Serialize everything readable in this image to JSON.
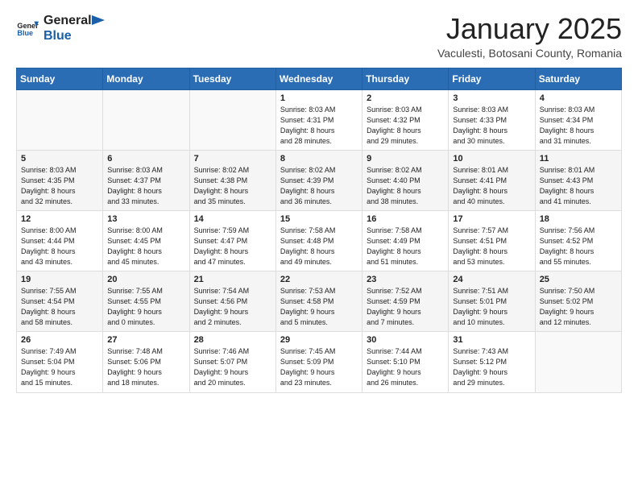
{
  "header": {
    "logo_line1": "General",
    "logo_line2": "Blue",
    "month": "January 2025",
    "location": "Vaculesti, Botosani County, Romania"
  },
  "weekdays": [
    "Sunday",
    "Monday",
    "Tuesday",
    "Wednesday",
    "Thursday",
    "Friday",
    "Saturday"
  ],
  "weeks": [
    [
      {
        "day": "",
        "info": ""
      },
      {
        "day": "",
        "info": ""
      },
      {
        "day": "",
        "info": ""
      },
      {
        "day": "1",
        "info": "Sunrise: 8:03 AM\nSunset: 4:31 PM\nDaylight: 8 hours\nand 28 minutes."
      },
      {
        "day": "2",
        "info": "Sunrise: 8:03 AM\nSunset: 4:32 PM\nDaylight: 8 hours\nand 29 minutes."
      },
      {
        "day": "3",
        "info": "Sunrise: 8:03 AM\nSunset: 4:33 PM\nDaylight: 8 hours\nand 30 minutes."
      },
      {
        "day": "4",
        "info": "Sunrise: 8:03 AM\nSunset: 4:34 PM\nDaylight: 8 hours\nand 31 minutes."
      }
    ],
    [
      {
        "day": "5",
        "info": "Sunrise: 8:03 AM\nSunset: 4:35 PM\nDaylight: 8 hours\nand 32 minutes."
      },
      {
        "day": "6",
        "info": "Sunrise: 8:03 AM\nSunset: 4:37 PM\nDaylight: 8 hours\nand 33 minutes."
      },
      {
        "day": "7",
        "info": "Sunrise: 8:02 AM\nSunset: 4:38 PM\nDaylight: 8 hours\nand 35 minutes."
      },
      {
        "day": "8",
        "info": "Sunrise: 8:02 AM\nSunset: 4:39 PM\nDaylight: 8 hours\nand 36 minutes."
      },
      {
        "day": "9",
        "info": "Sunrise: 8:02 AM\nSunset: 4:40 PM\nDaylight: 8 hours\nand 38 minutes."
      },
      {
        "day": "10",
        "info": "Sunrise: 8:01 AM\nSunset: 4:41 PM\nDaylight: 8 hours\nand 40 minutes."
      },
      {
        "day": "11",
        "info": "Sunrise: 8:01 AM\nSunset: 4:43 PM\nDaylight: 8 hours\nand 41 minutes."
      }
    ],
    [
      {
        "day": "12",
        "info": "Sunrise: 8:00 AM\nSunset: 4:44 PM\nDaylight: 8 hours\nand 43 minutes."
      },
      {
        "day": "13",
        "info": "Sunrise: 8:00 AM\nSunset: 4:45 PM\nDaylight: 8 hours\nand 45 minutes."
      },
      {
        "day": "14",
        "info": "Sunrise: 7:59 AM\nSunset: 4:47 PM\nDaylight: 8 hours\nand 47 minutes."
      },
      {
        "day": "15",
        "info": "Sunrise: 7:58 AM\nSunset: 4:48 PM\nDaylight: 8 hours\nand 49 minutes."
      },
      {
        "day": "16",
        "info": "Sunrise: 7:58 AM\nSunset: 4:49 PM\nDaylight: 8 hours\nand 51 minutes."
      },
      {
        "day": "17",
        "info": "Sunrise: 7:57 AM\nSunset: 4:51 PM\nDaylight: 8 hours\nand 53 minutes."
      },
      {
        "day": "18",
        "info": "Sunrise: 7:56 AM\nSunset: 4:52 PM\nDaylight: 8 hours\nand 55 minutes."
      }
    ],
    [
      {
        "day": "19",
        "info": "Sunrise: 7:55 AM\nSunset: 4:54 PM\nDaylight: 8 hours\nand 58 minutes."
      },
      {
        "day": "20",
        "info": "Sunrise: 7:55 AM\nSunset: 4:55 PM\nDaylight: 9 hours\nand 0 minutes."
      },
      {
        "day": "21",
        "info": "Sunrise: 7:54 AM\nSunset: 4:56 PM\nDaylight: 9 hours\nand 2 minutes."
      },
      {
        "day": "22",
        "info": "Sunrise: 7:53 AM\nSunset: 4:58 PM\nDaylight: 9 hours\nand 5 minutes."
      },
      {
        "day": "23",
        "info": "Sunrise: 7:52 AM\nSunset: 4:59 PM\nDaylight: 9 hours\nand 7 minutes."
      },
      {
        "day": "24",
        "info": "Sunrise: 7:51 AM\nSunset: 5:01 PM\nDaylight: 9 hours\nand 10 minutes."
      },
      {
        "day": "25",
        "info": "Sunrise: 7:50 AM\nSunset: 5:02 PM\nDaylight: 9 hours\nand 12 minutes."
      }
    ],
    [
      {
        "day": "26",
        "info": "Sunrise: 7:49 AM\nSunset: 5:04 PM\nDaylight: 9 hours\nand 15 minutes."
      },
      {
        "day": "27",
        "info": "Sunrise: 7:48 AM\nSunset: 5:06 PM\nDaylight: 9 hours\nand 18 minutes."
      },
      {
        "day": "28",
        "info": "Sunrise: 7:46 AM\nSunset: 5:07 PM\nDaylight: 9 hours\nand 20 minutes."
      },
      {
        "day": "29",
        "info": "Sunrise: 7:45 AM\nSunset: 5:09 PM\nDaylight: 9 hours\nand 23 minutes."
      },
      {
        "day": "30",
        "info": "Sunrise: 7:44 AM\nSunset: 5:10 PM\nDaylight: 9 hours\nand 26 minutes."
      },
      {
        "day": "31",
        "info": "Sunrise: 7:43 AM\nSunset: 5:12 PM\nDaylight: 9 hours\nand 29 minutes."
      },
      {
        "day": "",
        "info": ""
      }
    ]
  ]
}
